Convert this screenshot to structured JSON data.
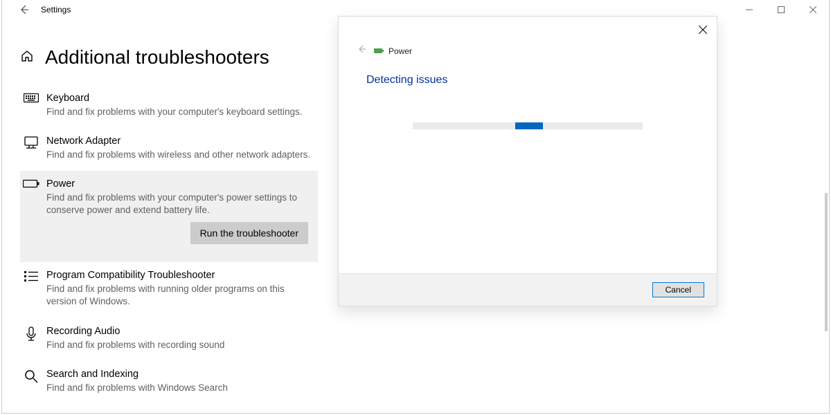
{
  "window": {
    "title": "Settings"
  },
  "page": {
    "title": "Additional troubleshooters"
  },
  "troubleshooters": [
    {
      "icon": "keyboard-icon",
      "title": "Keyboard",
      "desc": "Find and fix problems with your computer's keyboard settings."
    },
    {
      "icon": "network-adapter-icon",
      "title": "Network Adapter",
      "desc": "Find and fix problems with wireless and other network adapters."
    },
    {
      "icon": "power-icon",
      "title": "Power",
      "desc": "Find and fix problems with your computer's power settings to conserve power and extend battery life.",
      "selected": true,
      "run_label": "Run the troubleshooter"
    },
    {
      "icon": "program-icon",
      "title": "Program Compatibility Troubleshooter",
      "desc": "Find and fix problems with running older programs on this version of Windows."
    },
    {
      "icon": "recording-icon",
      "title": "Recording Audio",
      "desc": "Find and fix problems with recording sound"
    },
    {
      "icon": "search-icon",
      "title": "Search and Indexing",
      "desc": "Find and fix problems with Windows Search"
    }
  ],
  "dialog": {
    "title": "Power",
    "status": "Detecting issues",
    "cancel": "Cancel"
  }
}
